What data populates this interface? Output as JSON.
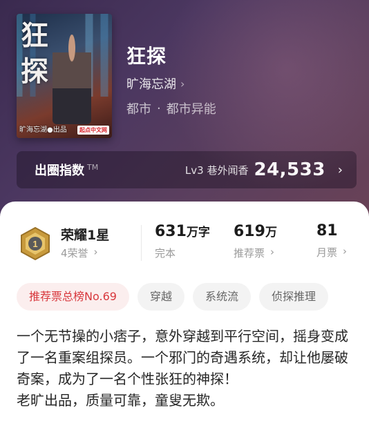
{
  "book": {
    "title": "狂探",
    "author": "旷海忘湖",
    "category": "都市",
    "subcategory": "都市异能",
    "separator": "·"
  },
  "cover": {
    "title_glyph_1": "狂",
    "title_glyph_2": "探",
    "credit": "旷海忘湖●出品",
    "publisher_badge": "起点中文网"
  },
  "index": {
    "label": "出圈指数",
    "tm": "TM",
    "level": "Lv3 巷外闻香",
    "score": "24,533"
  },
  "honor": {
    "title": "荣耀1星",
    "sub": "4荣誉",
    "medal_number": "1"
  },
  "stats": [
    {
      "value": "631",
      "unit": "万字",
      "label": "完本",
      "has_chevron": false
    },
    {
      "value": "619",
      "unit": "万",
      "label": "推荐票",
      "has_chevron": true
    },
    {
      "value": "81",
      "unit": "",
      "label": "月票",
      "has_chevron": true
    }
  ],
  "tags": [
    "推荐票总榜No.69",
    "穿越",
    "系统流",
    "侦探推理"
  ],
  "description": [
    "一个无节操的小痞子，意外穿越到平行空间，摇身变成了一名重案组探员。一个邪门的奇遇系统，却让他屡破奇案，成为了一名个性张狂的神探！",
    "老旷出品，质量可靠，童叟无欺。"
  ],
  "icons": {
    "chevron": "chevron-right-icon",
    "medal": "honor-medal-icon"
  },
  "colors": {
    "hero_bg": "#4b3760",
    "accent_red": "#d8383d",
    "medal_gold": "#c89a3c"
  }
}
